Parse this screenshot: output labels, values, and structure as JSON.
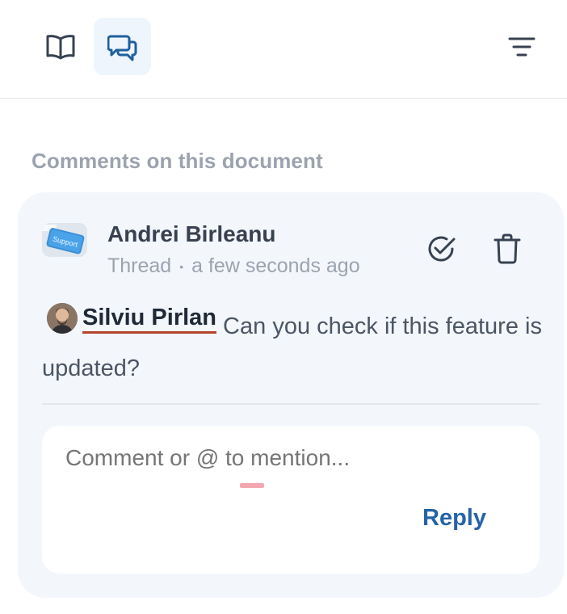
{
  "toolbar": {
    "book_icon": "book-open-icon",
    "comments_icon": "chat-bubbles-icon",
    "filter_icon": "filter-lines-icon",
    "active_color": "#eef5fc"
  },
  "panel": {
    "title": "Comments on this document"
  },
  "comment": {
    "author": "Andrei Birleanu",
    "avatar_text": "Support",
    "type": "Thread",
    "separator": "•",
    "time": "a few seconds ago",
    "mention_name": "Silviu Pirlan",
    "text": " Can you check if this feature is updated?",
    "resolve_icon": "check-circle-icon",
    "delete_icon": "trash-icon"
  },
  "reply": {
    "placeholder": "Comment or @ to mention...",
    "button_label": "Reply",
    "accent_color": "#2563a6"
  }
}
